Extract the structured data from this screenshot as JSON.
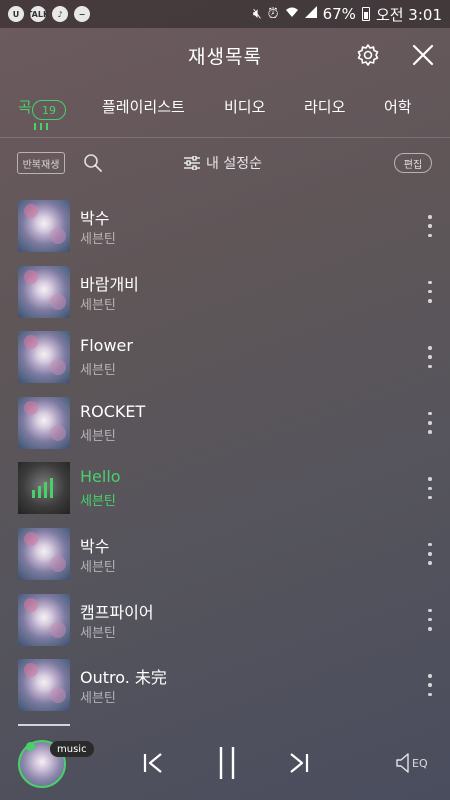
{
  "status_bar": {
    "left_icons": [
      "u-plus-icon",
      "talk-icon",
      "music-note-icon",
      "minus-circle-icon"
    ],
    "right_icons": [
      "mute-icon",
      "alarm-icon",
      "wifi-icon",
      "signal-icon"
    ],
    "battery": "67%",
    "time": "오전 3:01"
  },
  "header": {
    "title": "재생목록",
    "settings_icon": "gear-icon",
    "close_icon": "close-icon"
  },
  "tabs": [
    {
      "label": "곡",
      "count": "19",
      "active": true
    },
    {
      "label": "플레이리스트"
    },
    {
      "label": "비디오"
    },
    {
      "label": "라디오"
    },
    {
      "label": "어학"
    }
  ],
  "toolbar": {
    "repeat_label": "반복재생",
    "sort_label": "내 설정순",
    "edit_label": "편집"
  },
  "songs": [
    {
      "title": "박수",
      "artist": "세븐틴",
      "playing": false
    },
    {
      "title": "바람개비",
      "artist": "세븐틴",
      "playing": false
    },
    {
      "title": "Flower",
      "artist": "세븐틴",
      "playing": false
    },
    {
      "title": "ROCKET",
      "artist": "세븐틴",
      "playing": false
    },
    {
      "title": "Hello",
      "artist": "세븐틴",
      "playing": true
    },
    {
      "title": "박수",
      "artist": "세븐틴",
      "playing": false
    },
    {
      "title": "캠프파이어",
      "artist": "세븐틴",
      "playing": false
    },
    {
      "title": "Outro. 未完",
      "artist": "세븐틴",
      "playing": false
    }
  ],
  "player": {
    "badge": "music",
    "eq_label": "EQ"
  },
  "colors": {
    "accent": "#48d16a"
  }
}
